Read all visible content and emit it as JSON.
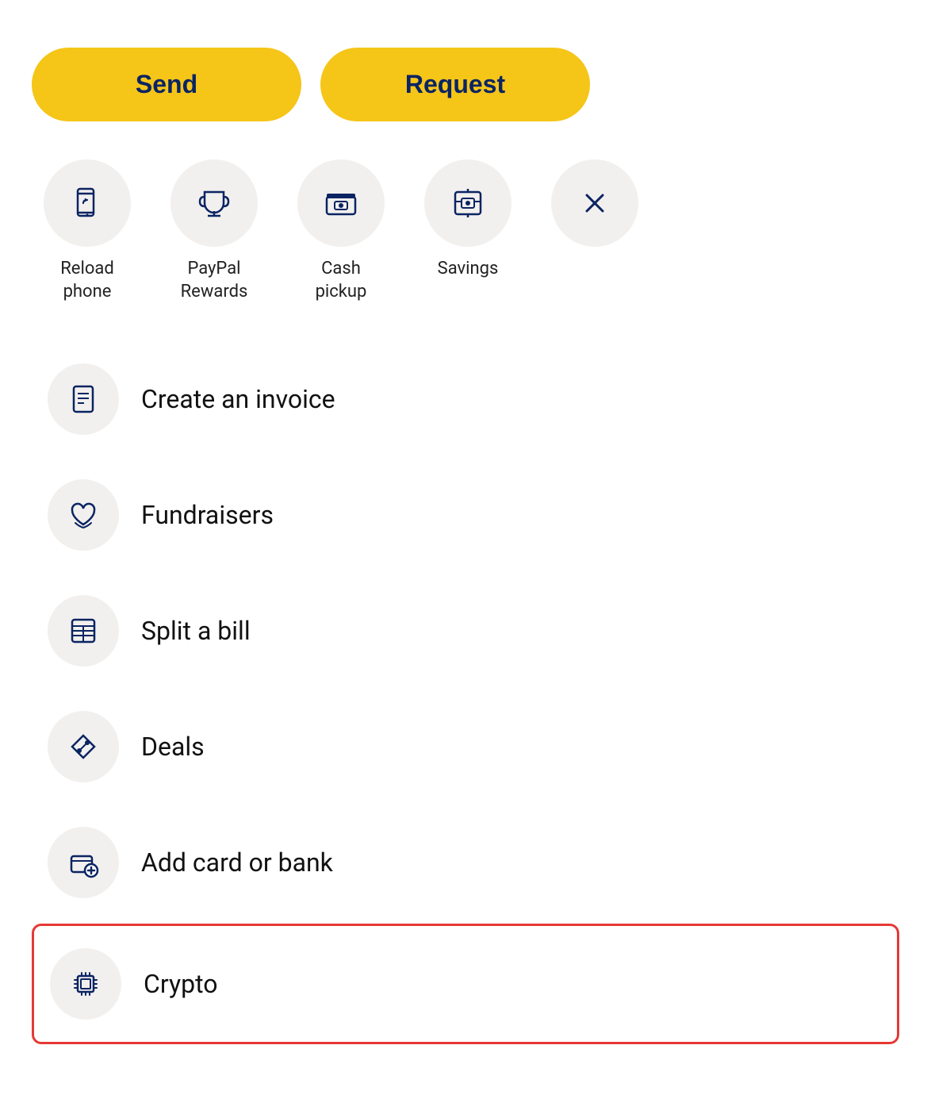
{
  "buttons": {
    "send_label": "Send",
    "request_label": "Request"
  },
  "shortcuts": [
    {
      "id": "reload-phone",
      "label": "Reload\nphone",
      "icon": "reload-phone-icon"
    },
    {
      "id": "paypal-rewards",
      "label": "PayPal\nRewards",
      "icon": "trophy-icon"
    },
    {
      "id": "cash-pickup",
      "label": "Cash\npickup",
      "icon": "cash-pickup-icon"
    },
    {
      "id": "savings",
      "label": "Savings",
      "icon": "savings-icon"
    },
    {
      "id": "close",
      "label": "",
      "icon": "close-icon"
    }
  ],
  "menu_items": [
    {
      "id": "create-invoice",
      "label": "Create an invoice",
      "icon": "invoice-icon",
      "highlighted": false
    },
    {
      "id": "fundraisers",
      "label": "Fundraisers",
      "icon": "fundraiser-icon",
      "highlighted": false
    },
    {
      "id": "split-bill",
      "label": "Split a bill",
      "icon": "split-bill-icon",
      "highlighted": false
    },
    {
      "id": "deals",
      "label": "Deals",
      "icon": "deals-icon",
      "highlighted": false
    },
    {
      "id": "add-card-bank",
      "label": "Add card or bank",
      "icon": "add-bank-icon",
      "highlighted": false
    },
    {
      "id": "crypto",
      "label": "Crypto",
      "icon": "crypto-icon",
      "highlighted": true
    }
  ]
}
